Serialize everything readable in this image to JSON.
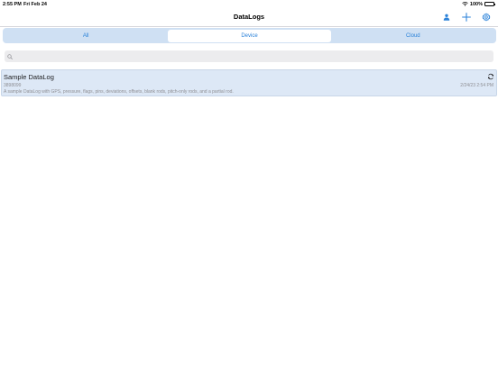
{
  "status_bar": {
    "time": "2:55 PM",
    "date": "Fri Feb 24",
    "battery_percent": "100%",
    "icons": [
      "wifi-icon",
      "battery-icon"
    ]
  },
  "nav": {
    "title": "DataLogs",
    "buttons": [
      "user-icon",
      "plus-icon",
      "gear-icon"
    ],
    "accent_color": "#2b82d9"
  },
  "segments": {
    "items": [
      {
        "label": "All",
        "selected": false
      },
      {
        "label": "Device",
        "selected": true
      },
      {
        "label": "Cloud",
        "selected": false
      }
    ]
  },
  "search": {
    "placeholder": "",
    "value": ""
  },
  "list": {
    "items": [
      {
        "title": "Sample DataLog",
        "id": "3898099",
        "date": "2/24/23 2:54 PM",
        "description": "A sample DataLog with GPS, pressure, flags, pins, deviations, offsets, blank rods, pitch-only rods, and a partial rod.",
        "icon": "sync-icon"
      }
    ]
  }
}
